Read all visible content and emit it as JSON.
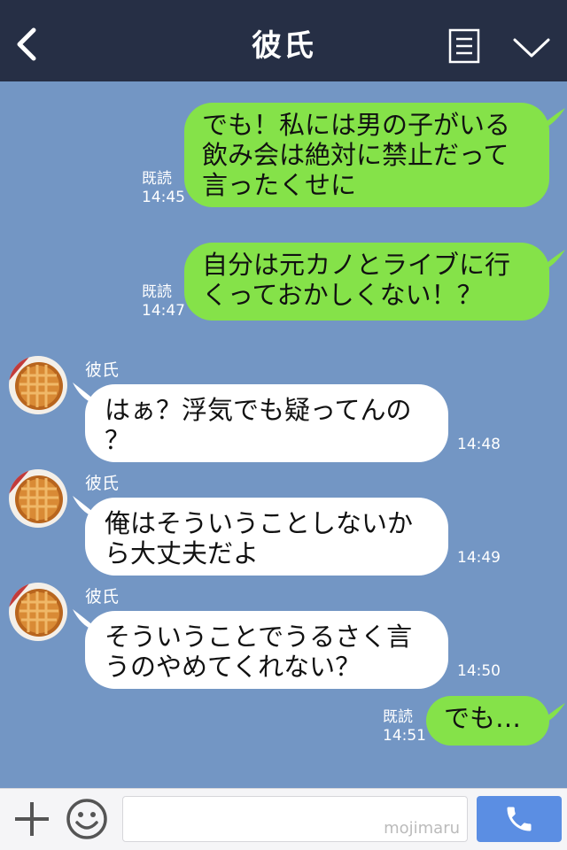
{
  "header": {
    "title": "彼氏",
    "back_icon": "chevron-left-icon",
    "menu_icon": "menu-icon",
    "collapse_icon": "chevron-down-icon",
    "background": "#262f45"
  },
  "chat": {
    "background": "#7396c4",
    "messages": [
      {
        "side": "out",
        "lines": [
          "でも！私には男の子がいる",
          "飲み会は絶対に禁止だって",
          "言ったくせに"
        ],
        "read": "既読",
        "time": "14:45"
      },
      {
        "side": "out",
        "lines": [
          "自分は元カノとライブに行",
          "くっておかしくない！？"
        ],
        "read": "既読",
        "time": "14:47"
      },
      {
        "side": "in",
        "sender": "彼氏",
        "lines": [
          "はぁ？浮気でも疑ってんの",
          "？"
        ],
        "time": "14:48"
      },
      {
        "side": "in",
        "sender": "彼氏",
        "lines": [
          "俺はそういうことしないか",
          "ら大丈夫だよ"
        ],
        "time": "14:49"
      },
      {
        "side": "in",
        "sender": "彼氏",
        "lines": [
          "そういうことでうるさく言",
          "うのやめてくれない？"
        ],
        "time": "14:50"
      },
      {
        "side": "out",
        "lines": [
          "でも…"
        ],
        "read": "既読",
        "time": "14:51"
      }
    ]
  },
  "input_bar": {
    "plus_icon": "plus-icon",
    "emoji_icon": "smiley-icon",
    "input_value": "",
    "watermark": "mojimaru",
    "call_icon": "phone-icon"
  },
  "colors": {
    "sent_bubble": "#85e249",
    "received_bubble": "#ffffff",
    "call_button": "#5b8ee3"
  }
}
